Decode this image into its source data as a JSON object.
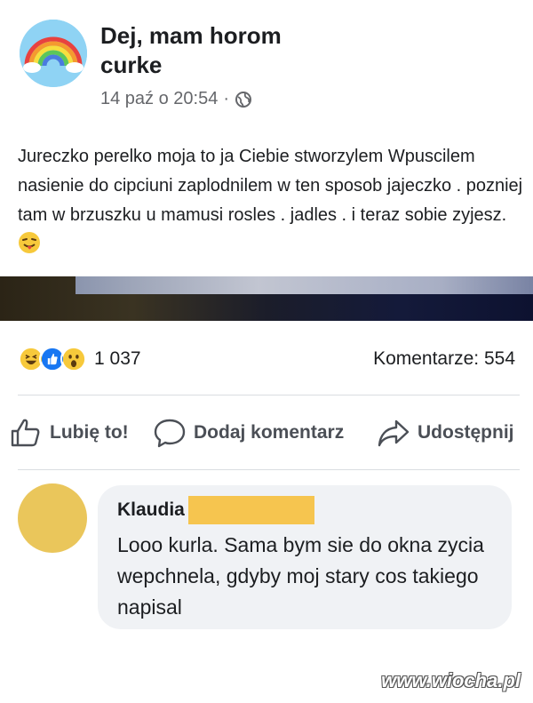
{
  "post": {
    "page_name": "Dej, mam horom curke",
    "timestamp": "14 paź o 20:54",
    "separator": "·",
    "privacy_icon": "globe-icon",
    "text": "Jureczko perelko moja to ja Ciebie stworzylem Wpuscilem nasienie do cipciuni zaplodnilem w ten sposob jajeczko . pozniej tam w brzuszku u mamusi rosles . jadles . i teraz sobie zyjesz.",
    "text_emoji": "winking-tongue-emoji"
  },
  "stats": {
    "reactions": [
      "haha",
      "like",
      "wow"
    ],
    "reaction_count": "1 037",
    "comments_label": "Komentarze: 554"
  },
  "actions": {
    "like": "Lubię to!",
    "comment": "Dodaj komentarz",
    "share": "Udostępnij"
  },
  "comment": {
    "author": "Klaudia",
    "text": "Looo kurla. Sama bym sie do okna zycia wepchnela, gdyby moj stary cos takiego napisal"
  },
  "watermark": "www.wiocha.pl",
  "colors": {
    "like_blue": "#1877f2",
    "reaction_yellow": "#f7c93b",
    "comment_bubble": "#f0f2f5",
    "redaction": "#f6c54f",
    "commenter_avatar": "#eac65b"
  }
}
